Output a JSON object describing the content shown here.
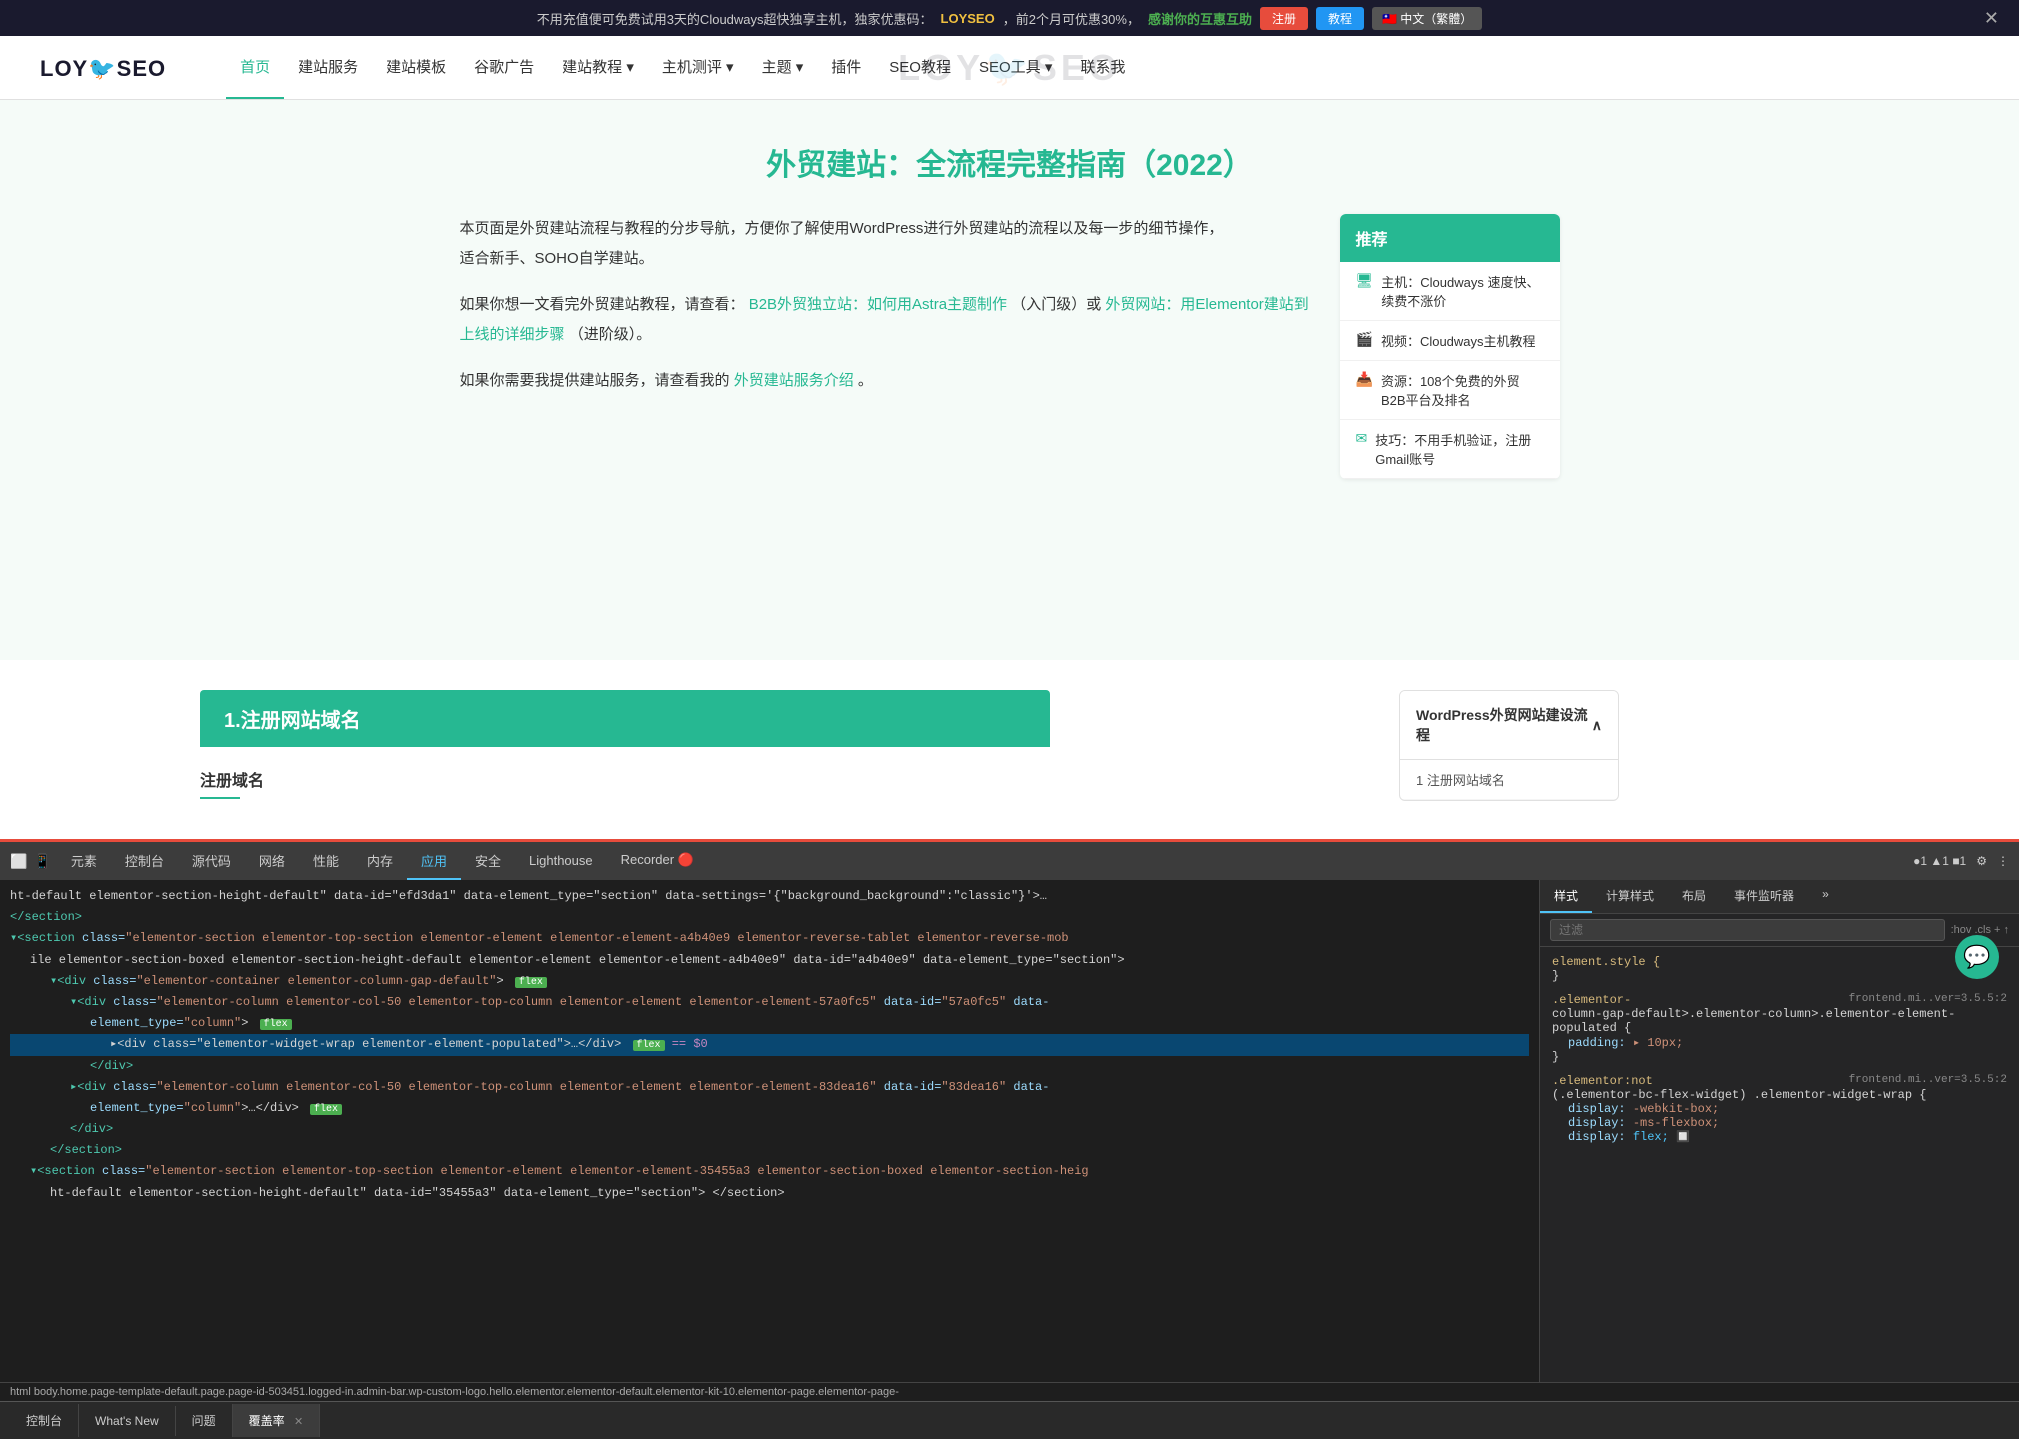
{
  "banner": {
    "text1": "不用充值便可免费试用3天的Cloudways超快独享主机，独家优惠码：",
    "code": "LOYSEO",
    "text2": "，前2个月可优惠30%，",
    "thanks": "感谢你的互惠互助",
    "reg_btn": "注册",
    "tutorial_btn": "教程",
    "lang_btn": "🇹🇼 中文（繁體）",
    "close": "✕"
  },
  "navbar": {
    "logo": "LOY SEO",
    "watermark": "LOY SEO",
    "menu": [
      {
        "label": "首页",
        "active": true
      },
      {
        "label": "建站服务"
      },
      {
        "label": "建站模板"
      },
      {
        "label": "谷歌广告"
      },
      {
        "label": "建站教程 ▾"
      },
      {
        "label": "主机测评 ▾"
      },
      {
        "label": "主题 ▾"
      },
      {
        "label": "插件"
      },
      {
        "label": "SEO教程"
      },
      {
        "label": "SEO工具 ▾"
      },
      {
        "label": "联系我"
      }
    ]
  },
  "main": {
    "title": "外贸建站：全流程完整指南（2022）",
    "para1": "本页面是外贸建站流程与教程的分步导航，方便你了解使用WordPress进行外贸建站的流程以及每一步的细节操作，",
    "para1b": "适合新手、SOHO自学建站。",
    "para2_prefix": "如果你想一文看完外贸建站教程，请查看：",
    "para2_link1": "B2B外贸独立站：如何用Astra主题制作",
    "para2_mid": "（入门级）或",
    "para2_link2": "外贸网站：用Elementor建站到上线的详细步骤",
    "para2_suffix": "（进阶级）。",
    "para3_prefix": "如果你需要我提供建站服务，请查看我的",
    "para3_link": "外贸建站服务介绍",
    "para3_suffix": "。"
  },
  "sidebar": {
    "header": "推荐",
    "items": [
      {
        "icon": "🖥",
        "text": "主机：Cloudways 速度快、续费不涨价"
      },
      {
        "icon": "🎬",
        "text": "视频：Cloudways主机教程"
      },
      {
        "icon": "📥",
        "text": "资源：108个免费的外贸B2B平台及排名"
      },
      {
        "icon": "✉",
        "text": "技巧：不用手机验证，注册Gmail账号"
      }
    ]
  },
  "section1": {
    "header": "1.注册网站域名",
    "subheader": "注册域名"
  },
  "toc": {
    "title": "WordPress外贸网站建设流程",
    "item1": "1 注册网站域名"
  },
  "devtools": {
    "tabs": [
      "元素",
      "控制台",
      "源代码",
      "网络",
      "性能",
      "内存",
      "应用",
      "安全",
      "Lighthouse",
      "Recorder 🔴"
    ],
    "active_tab": "应用",
    "toolbar_right": "● 1  ▲ 1  ■ 1",
    "styles_tabs": [
      "样式",
      "计算样式",
      "布局",
      "事件监听器",
      "»"
    ],
    "filter_placeholder": "过滤",
    "filter_pseudo": ":hov  .cls  +  ↑",
    "dom_lines": [
      {
        "indent": 0,
        "content": "ht-default elementor-section-height-default\" data-id=\"efd3da1\" data-element_type=\"section\" data-settings=\"{\\\"background_background\\\":\\\"classic\\\"}\"\\u003e…",
        "selected": false
      },
      {
        "indent": 0,
        "content": "</section>",
        "selected": false
      },
      {
        "indent": 0,
        "content": "▾<section class=\"elementor-section elementor-top-section elementor-element elementor-element-a4b40e9 elementor-reverse-tablet elementor-reverse-mob",
        "selected": false
      },
      {
        "indent": 1,
        "content": "ile elementor-section-boxed elementor-section-height-default elementor-element elementor-element-a4b40e9\" data-id=\"a4b40e9\" data-element_type=\"section\">",
        "selected": false
      },
      {
        "indent": 2,
        "content": "▾<div class=\"elementor-container elementor-column-gap-default\"> flex",
        "selected": false,
        "badge": "flex"
      },
      {
        "indent": 3,
        "content": "▾<div class=\"elementor-column elementor-col-50 elementor-top-column elementor-element elementor-element-57a0fc5\" data-id=\"57a0fc5\" data-",
        "selected": false
      },
      {
        "indent": 4,
        "content": "element_type=\"column\"> flex",
        "badge": "flex",
        "selected": false
      },
      {
        "indent": 5,
        "content": "▸<div class=\"elementor-widget-wrap elementor-element-populated\">…</div> flex == $0",
        "badge": "flex",
        "dollar": true,
        "selected": true
      },
      {
        "indent": 4,
        "content": "</div>",
        "selected": false
      },
      {
        "indent": 3,
        "content": "▸<div class=\"elementor-column elementor-col-50 elementor-top-column elementor-element elementor-element-83dea16\" data-id=\"83dea16\" data-",
        "selected": false
      },
      {
        "indent": 4,
        "content": "element_type=\"column\">…</div> flex",
        "badge": "flex",
        "selected": false
      },
      {
        "indent": 3,
        "content": "</div>",
        "selected": false
      },
      {
        "indent": 2,
        "content": "</section>",
        "selected": false
      },
      {
        "indent": 1,
        "content": "▾<section class=\"elementor-section elementor-top-section elementor-element elementor-element-35455a3 elementor-section-boxed elementor-section-heig",
        "selected": false
      },
      {
        "indent": 2,
        "content": "ht-default elementor-section-height-default\" data-id=\"35455a3\" data-element_type=\"section\"> </section>",
        "selected": false
      }
    ],
    "statusbar": "html  body.home.page-template-default.page.page-id-503451.logged-in.admin-bar.wp-custom-logo.hello.elementor.elementor-default.elementor-kit-10.elementor-page.elementor-page-",
    "css_rules": [
      {
        "selector": "element.style {",
        "props": [
          {
            "prop": "",
            "val": "}"
          }
        ]
      },
      {
        "selector": ".elementor-",
        "source": "frontend.mi..ver=3.5.5:2",
        "props": [
          {
            "prop": "column-gap-default>.elementor-column>.elementor-element-populated {"
          },
          {
            "prop": "padding:",
            "val": "▸ 10px;"
          },
          {
            "prop": "}"
          }
        ]
      },
      {
        "selector": ".elementor:not",
        "source": "frontend.mi..ver=3.5.5:2",
        "props": [
          {
            "prop": "(.elementor-bc-flex-widget) .elementor-widget-wrap {"
          },
          {
            "prop": "display:",
            "val": "-webkit-box;"
          },
          {
            "prop": "display:",
            "val": "-ms-flexbox;"
          },
          {
            "prop": "display:",
            "val": "flex; 🔲"
          }
        ]
      }
    ]
  },
  "bottom_tabs": [
    {
      "label": "控制台",
      "active": false
    },
    {
      "label": "What's New",
      "active": false
    },
    {
      "label": "问题",
      "active": false
    },
    {
      "label": "覆盖率",
      "active": true,
      "closeable": true
    }
  ]
}
